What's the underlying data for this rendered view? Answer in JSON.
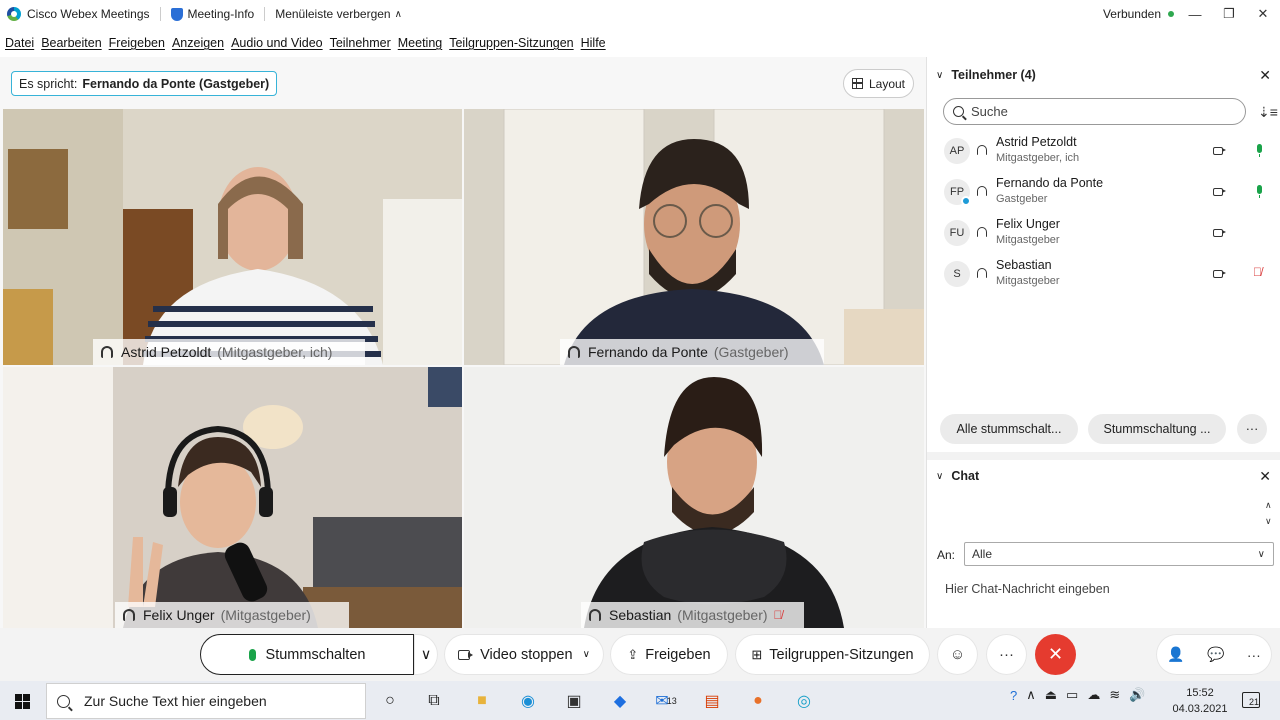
{
  "titlebar": {
    "app_title": "Cisco Webex Meetings",
    "meeting_info": "Meeting-Info",
    "menu_toggle": "Menüleiste verbergen",
    "status": "Verbunden"
  },
  "menu": {
    "items": [
      "Datei",
      "Bearbeiten",
      "Freigeben",
      "Anzeigen",
      "Audio und Video",
      "Teilnehmer",
      "Meeting",
      "Teilgruppen-Sitzungen",
      "Hilfe"
    ]
  },
  "stage": {
    "speaking_prefix": "Es spricht:",
    "speaking_name": "Fernando da Ponte (Gastgeber)",
    "layout_label": "Layout",
    "tiles": [
      {
        "name": "Astrid Petzoldt",
        "role": "(Mitgastgeber, ich)"
      },
      {
        "name": "Fernando da Ponte",
        "role": "(Gastgeber)"
      },
      {
        "name": "Felix Unger",
        "role": "(Mitgastgeber)"
      },
      {
        "name": "Sebastian",
        "role": "(Mitgastgeber)"
      }
    ]
  },
  "participants": {
    "header": "Teilnehmer (4)",
    "search_placeholder": "Suche",
    "list": [
      {
        "initials": "AP",
        "name": "Astrid Petzoldt",
        "role": "Mitgastgeber, ich",
        "mic": "on"
      },
      {
        "initials": "FP",
        "name": "Fernando da Ponte",
        "role": "Gastgeber",
        "mic": "on"
      },
      {
        "initials": "FU",
        "name": "Felix Unger",
        "role": "Mitgastgeber",
        "mic": "none"
      },
      {
        "initials": "S",
        "name": "Sebastian",
        "role": "Mitgastgeber",
        "mic": "muted"
      }
    ],
    "mute_all": "Alle stummschalt...",
    "unmute": "Stummschaltung ...",
    "more": "···"
  },
  "chat": {
    "header": "Chat",
    "to_label": "An:",
    "to_value": "Alle",
    "placeholder": "Hier Chat-Nachricht eingeben"
  },
  "controls": {
    "mute": "Stummschalten",
    "video": "Video stoppen",
    "share": "Freigeben",
    "breakout": "Teilgruppen-Sitzungen",
    "more": "···"
  },
  "taskbar": {
    "search_placeholder": "Zur Suche Text hier eingeben",
    "mail_badge": "13",
    "time": "15:52",
    "date": "04.03.2021",
    "notif_count": "21"
  },
  "colors": {
    "accent_border": "#22b6e4",
    "mic_on": "#1aa34a",
    "mic_off": "#d93a3a",
    "end_call": "#e53b2f",
    "connected": "#2fa84f"
  }
}
